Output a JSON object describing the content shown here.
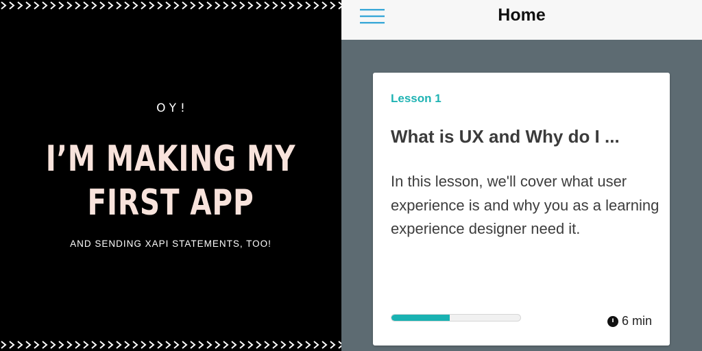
{
  "promo": {
    "eyebrow": "OY!",
    "headline_line1": "I’M MAKING MY",
    "headline_line2": "FIRST APP",
    "subheadline": "AND SENDING XAPI STATEMENTS, TOO!",
    "colors": {
      "background": "#000000",
      "headline": "#f8e3dc",
      "text": "#ffffff"
    }
  },
  "app": {
    "nav": {
      "title": "Home",
      "menu_icon": "hamburger-menu-icon"
    },
    "lesson_card": {
      "label": "Lesson 1",
      "title": "What is UX and Why do I ...",
      "description": "In this lesson, we'll cover what user experience is and why you as a learning experience designer need it.",
      "progress_percent": 45,
      "duration": "6 min",
      "duration_icon": "clock-icon"
    },
    "colors": {
      "accent": "#1fb3b3",
      "screen_background": "#5d6b72",
      "nav_background": "#f7f7f7",
      "menu_icon": "#3aa8d8"
    }
  }
}
